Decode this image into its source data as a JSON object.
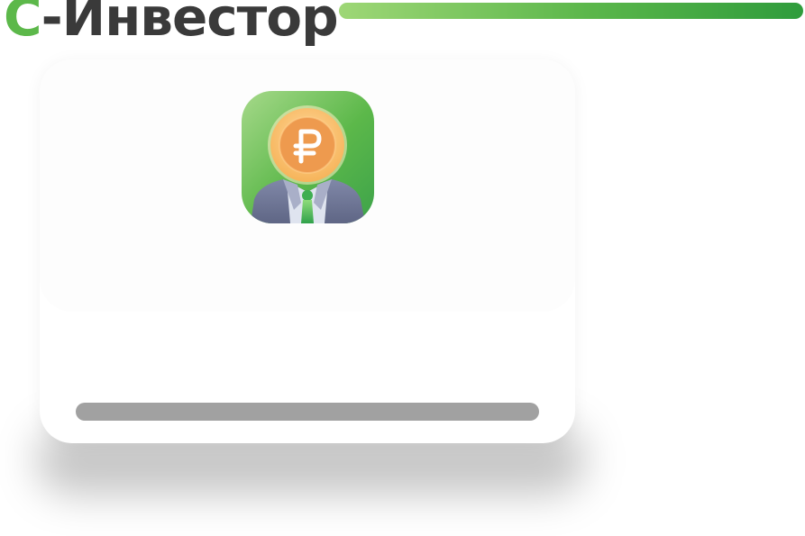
{
  "header": {
    "title_accent": "С",
    "title_rest": "-Инвестор"
  },
  "colors": {
    "accent": "#5cb84a",
    "title_text": "#3a3a3a",
    "progress_track": "#a1a1a1"
  },
  "card": {
    "icon_name": "investor-app-icon",
    "progress": 0
  }
}
